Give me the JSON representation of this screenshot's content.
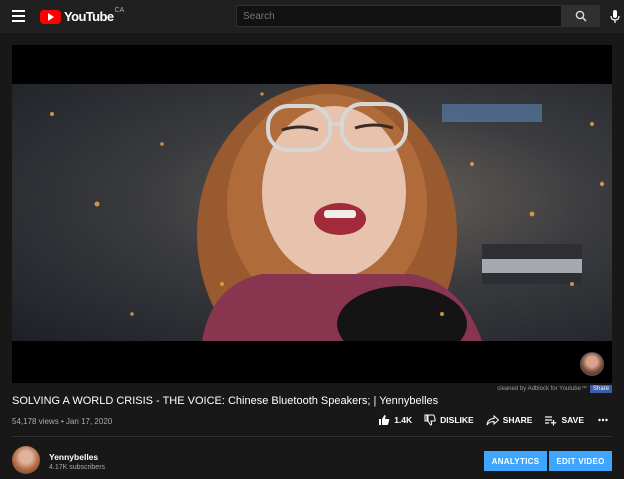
{
  "header": {
    "logo_text": "YouTube",
    "country": "CA",
    "search_placeholder": "Search"
  },
  "video": {
    "adblock_note": "cleaned by Adblock for Youtube™",
    "adblock_share": "Share",
    "title": "SOLVING A WORLD CRISIS - THE VOICE: Chinese Bluetooth Speakers; | Yennybelles",
    "views": "54,178 views",
    "date": "Jan 17, 2020"
  },
  "actions": {
    "like_count": "1.4K",
    "dislike_label": "DISLIKE",
    "share_label": "SHARE",
    "save_label": "SAVE"
  },
  "channel": {
    "name": "Yennybelles",
    "subscribers": "4.17K subscribers"
  },
  "buttons": {
    "analytics": "ANALYTICS",
    "edit_video": "EDIT VIDEO"
  },
  "colors": {
    "brand_red": "#ff0000",
    "accent_blue": "#3ea6ff",
    "background": "#181818"
  }
}
